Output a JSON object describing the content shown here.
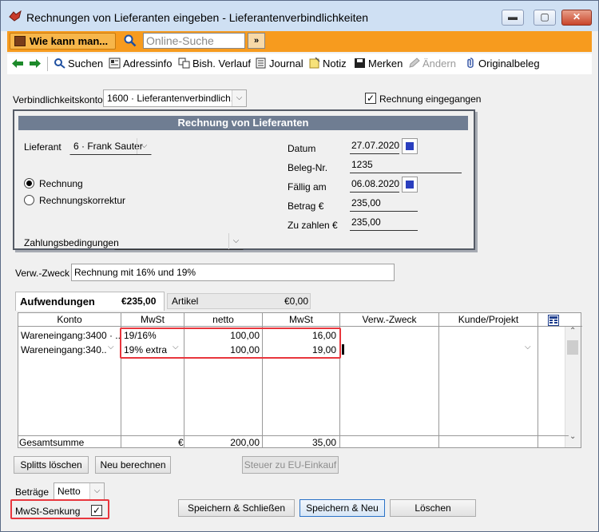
{
  "window": {
    "title": "Rechnungen von Lieferanten eingeben - Lieferantenverbindlichkeiten",
    "controls": {
      "minimize": "▬",
      "maximize": "▢",
      "close": "✕"
    }
  },
  "helpbar": {
    "help_label": "Wie kann man...",
    "search_placeholder": "Online-Suche",
    "go_label": "»"
  },
  "toolbar": {
    "suchen": "Suchen",
    "adressinfo": "Adressinfo",
    "verlauf": "Bish. Verlauf",
    "journal": "Journal",
    "notiz": "Notiz",
    "merken": "Merken",
    "andern": "Ändern",
    "originalbeleg": "Originalbeleg"
  },
  "form": {
    "account_label": "Verbindlichkeitskonto",
    "account_value": "1600 · Lieferantenverbindlich...",
    "received_label": "Rechnung eingegangen",
    "received_checked": true,
    "panel_title": "Rechnung von Lieferanten",
    "supplier_label": "Lieferant",
    "supplier_value": "6 · Frank Sauter",
    "radio_invoice": "Rechnung",
    "radio_correction": "Rechnungskorrektur",
    "terms_label": "Zahlungsbedingungen",
    "terms_value": "",
    "date_label": "Datum",
    "date_value": "27.07.2020",
    "beleg_label": "Beleg-Nr.",
    "beleg_value": "1235",
    "due_label": "Fällig am",
    "due_value": "06.08.2020",
    "amount_label": "Betrag €",
    "amount_value": "235,00",
    "topay_label": "Zu zahlen €",
    "topay_value": "235,00",
    "purpose_label": "Verw.-Zweck",
    "purpose_value": "Rechnung mit 16% und 19%"
  },
  "tabs": {
    "expenses_label": "Aufwendungen",
    "expenses_total": "€235,00",
    "items_label": "Artikel",
    "items_total": "€0,00"
  },
  "grid": {
    "headers": [
      "Konto",
      "MwSt",
      "netto",
      "MwSt",
      "Verw.-Zweck",
      "Kunde/Projekt"
    ],
    "rows": [
      {
        "konto": "Wareneingang:3400 · ...",
        "mwst_code": "19/16%",
        "netto": "100,00",
        "mwst": "16,00"
      },
      {
        "konto": "Wareneingang:340...",
        "mwst_code": "19% extra",
        "netto": "100,00",
        "mwst": "19,00"
      }
    ],
    "total_label": "Gesamtsumme",
    "total_currency": "€",
    "total_netto": "200,00",
    "total_mwst": "35,00"
  },
  "buttons": {
    "splits_delete": "Splitts löschen",
    "recalc": "Neu berechnen",
    "eu_tax": "Steuer zu EU-Einkauf",
    "save_close": "Speichern & Schließen",
    "save_new": "Speichern & Neu",
    "delete": "Löschen"
  },
  "footer": {
    "amounts_label": "Beträge",
    "amounts_value": "Netto",
    "vat_reduction_label": "MwSt-Senkung",
    "vat_reduction_checked": true
  },
  "colors": {
    "titlebar": "#cfe0f3",
    "helpbar": "#f79b1e",
    "panel_header": "#6f7d92",
    "highlight": "#e8363d"
  }
}
